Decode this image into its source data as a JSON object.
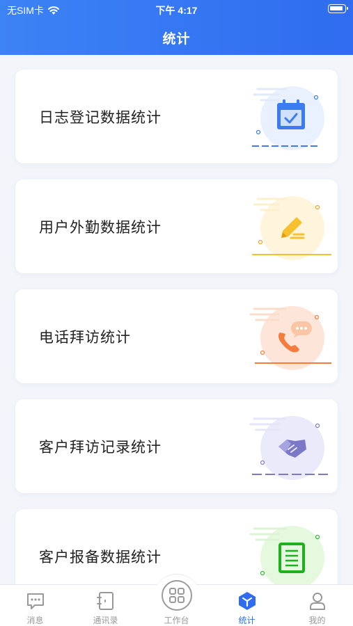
{
  "status_bar": {
    "carrier": "无SIM卡",
    "time": "下午 4:17"
  },
  "header": {
    "title": "统计"
  },
  "cards": [
    {
      "label": "日志登记数据统计",
      "icon": "calendar-check-icon",
      "color": "#3d7cf0"
    },
    {
      "label": "用户外勤数据统计",
      "icon": "pencil-edit-icon",
      "color": "#f7c12e"
    },
    {
      "label": "电话拜访统计",
      "icon": "phone-chat-icon",
      "color": "#f47c3c"
    },
    {
      "label": "客户拜访记录统计",
      "icon": "handshake-icon",
      "color": "#7b79c7"
    },
    {
      "label": "客户报备数据统计",
      "icon": "document-list-icon",
      "color": "#2db82d"
    }
  ],
  "tabbar": {
    "items": [
      {
        "label": "消息",
        "icon": "message-icon"
      },
      {
        "label": "通讯录",
        "icon": "contacts-book-icon"
      },
      {
        "label": "工作台",
        "icon": "workbench-grid-icon"
      },
      {
        "label": "统计",
        "icon": "statistics-cube-icon",
        "active": true
      },
      {
        "label": "我的",
        "icon": "person-icon"
      }
    ]
  }
}
